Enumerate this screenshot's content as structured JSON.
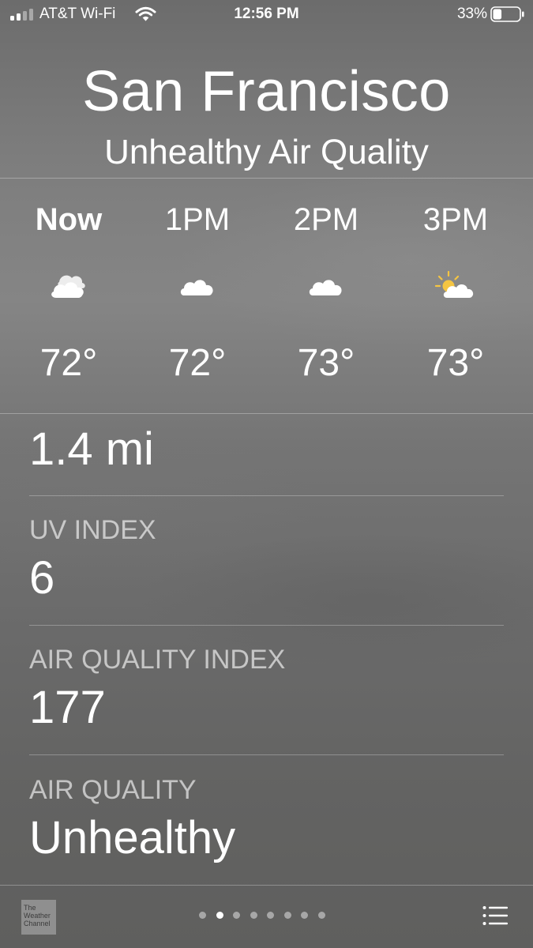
{
  "status_bar": {
    "carrier": "AT&T Wi-Fi",
    "time": "12:56 PM",
    "battery_percent": "33%",
    "battery_level": 0.33,
    "signal_bars_active": 2,
    "signal_bars_total": 4
  },
  "header": {
    "city": "San Francisco",
    "condition": "Unhealthy Air Quality"
  },
  "hourly": [
    {
      "label": "Now",
      "icon": "mostly-cloudy-icon",
      "temp": "72°"
    },
    {
      "label": "1PM",
      "icon": "cloud-icon",
      "temp": "72°"
    },
    {
      "label": "2PM",
      "icon": "cloud-icon",
      "temp": "73°"
    },
    {
      "label": "3PM",
      "icon": "partly-sunny-icon",
      "temp": "73°"
    }
  ],
  "details": {
    "visibility_value": "1.4 mi",
    "uv_label": "UV INDEX",
    "uv_value": "6",
    "aqi_label": "AIR QUALITY INDEX",
    "aqi_value": "177",
    "air_quality_label": "AIR QUALITY",
    "air_quality_value": "Unhealthy"
  },
  "footer": {
    "logo_text": "The Weather Channel",
    "logo_icon": "the-weather-channel-logo",
    "page_count": 8,
    "active_page": 1,
    "list_icon": "list-icon"
  },
  "colors": {
    "text": "#ffffff",
    "sun": "#f5c542",
    "logo_bg": "#8f8f8f"
  }
}
